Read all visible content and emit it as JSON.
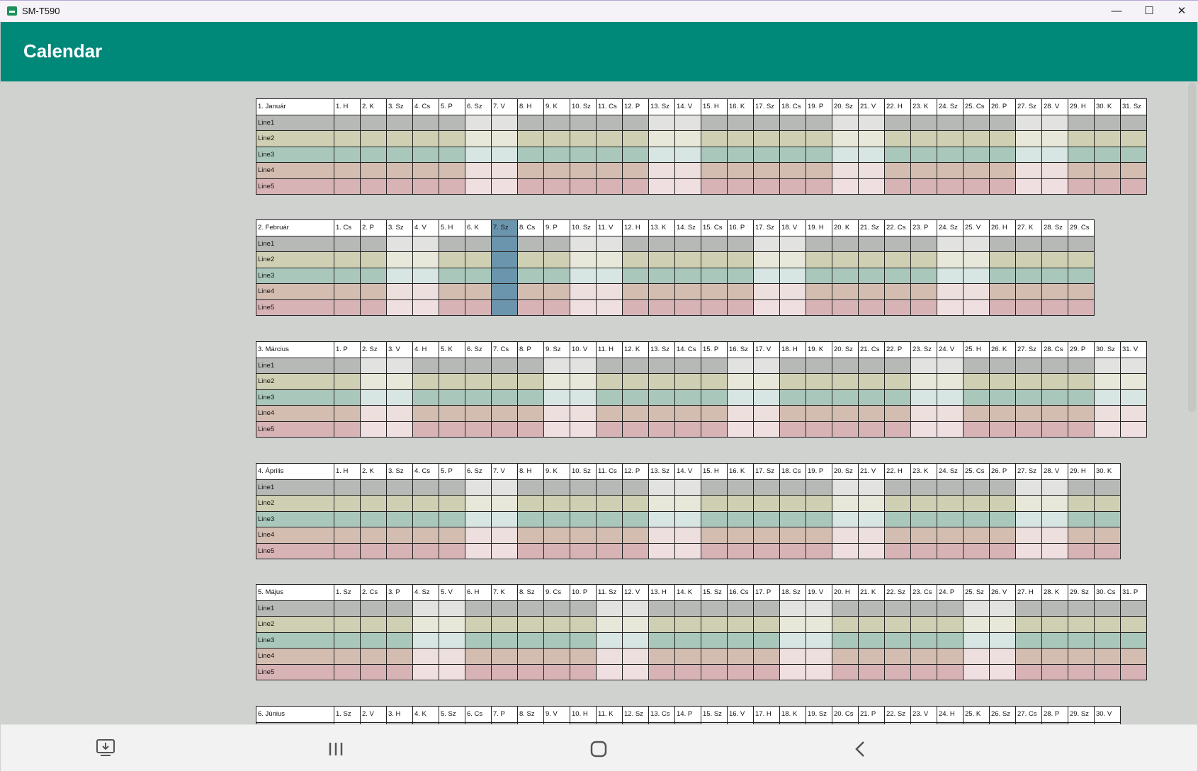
{
  "window": {
    "title": "SM-T590",
    "minimize": "—",
    "maximize": "☐",
    "close": "✕"
  },
  "appbar": {
    "title": "Calendar"
  },
  "colors": {
    "workday": {
      "Line1": "#b7b9b6",
      "Line2": "#cfcfb4",
      "Line3": "#a9c7bb",
      "Line4": "#d3bdb1",
      "Line5": "#d7b3b6"
    },
    "holiday": {
      "Line1": "#e2e3e0",
      "Line2": "#e8e8da",
      "Line3": "#d7e6e3",
      "Line4": "#eddfdd",
      "Line5": "#f0dfe1"
    }
  },
  "line_labels": [
    "Line1",
    "Line2",
    "Line3",
    "Line4",
    "Line5"
  ],
  "months": [
    {
      "name": "1. Január",
      "start": "H",
      "days": 31,
      "selected": null
    },
    {
      "name": "2. Február",
      "start": "Cs",
      "days": 29,
      "selected": 7
    },
    {
      "name": "3. Március",
      "start": "P",
      "days": 31,
      "selected": null
    },
    {
      "name": "4. Április",
      "start": "H",
      "days": 30,
      "selected": null
    },
    {
      "name": "5. Május",
      "start": "Sz",
      "days": 31,
      "selected": null
    },
    {
      "name": "6. Június",
      "start": "Sz",
      "days": 30,
      "selected": null
    }
  ],
  "weekday_order": [
    "H",
    "K",
    "Sz",
    "Cs",
    "P",
    "Sz",
    "V"
  ],
  "nav": {
    "recent_label": "|||",
    "home_label": "○",
    "back_label": "‹"
  }
}
